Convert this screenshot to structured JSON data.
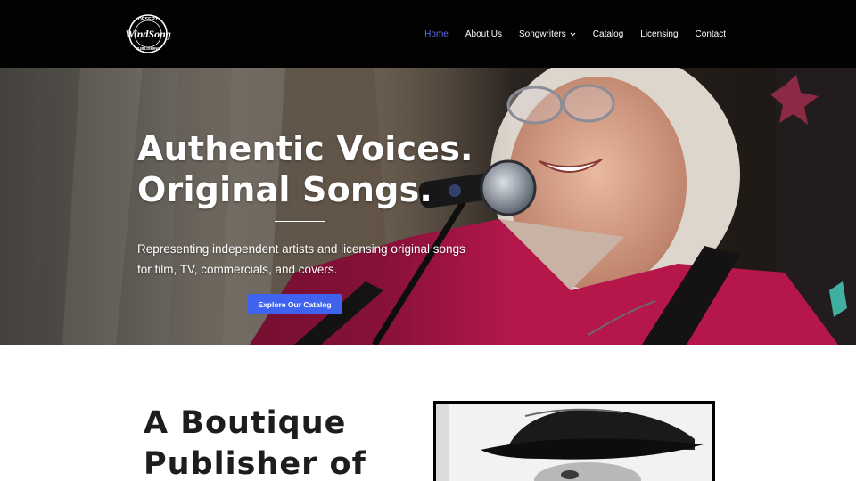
{
  "header": {
    "logo": {
      "text_top": "DESERT",
      "text_main": "WindSong",
      "text_bottom": "PUBLISHING"
    },
    "nav": [
      {
        "label": "Home",
        "active": true
      },
      {
        "label": "About Us"
      },
      {
        "label": "Songwriters",
        "has_dropdown": true
      },
      {
        "label": "Catalog"
      },
      {
        "label": "Licensing"
      },
      {
        "label": "Contact"
      }
    ]
  },
  "hero": {
    "title_line1": "Authentic Voices.",
    "title_line2": "Original Songs.",
    "subtitle": "Representing independent artists and licensing original songs for film, TV, commercials, and covers.",
    "cta_label": "Explore Our Catalog"
  },
  "content": {
    "heading_line1": "A Boutique",
    "heading_line2": "Publisher of"
  },
  "colors": {
    "header_bg": "#020202",
    "nav_active": "#5a6cf0",
    "cta_bg": "#3f63ee",
    "shirt": "#b5174b"
  }
}
